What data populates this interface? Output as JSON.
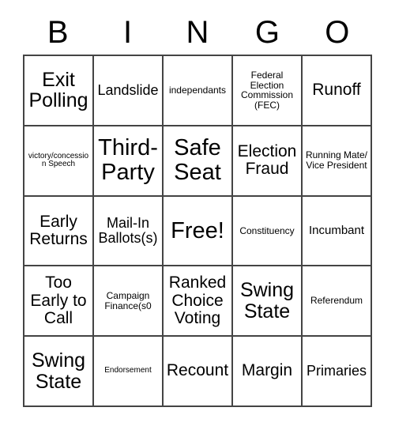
{
  "card": {
    "title": "BINGO",
    "header_letters": [
      "B",
      "I",
      "N",
      "G",
      "O"
    ],
    "free_space": {
      "row": 2,
      "col": 2,
      "label": "Free!"
    },
    "grid_size": "5x5",
    "rows": [
      [
        {
          "text": "Exit Polling",
          "size": "xl"
        },
        {
          "text": "Landslide",
          "size": "m"
        },
        {
          "text": "independants",
          "size": "xs"
        },
        {
          "text": "Federal Election Commission (FEC)",
          "size": "xs"
        },
        {
          "text": "Runoff",
          "size": "l"
        }
      ],
      [
        {
          "text": "victory/concession Speech",
          "size": "xxs"
        },
        {
          "text": "Third-Party",
          "size": "xxl"
        },
        {
          "text": "Safe Seat",
          "size": "xxl"
        },
        {
          "text": "Election Fraud",
          "size": "l"
        },
        {
          "text": "Running Mate/ Vice President",
          "size": "xs"
        }
      ],
      [
        {
          "text": "Early Returns",
          "size": "l"
        },
        {
          "text": "Mail-In Ballots(s)",
          "size": "m"
        },
        {
          "text": "Free!",
          "size": "xxl"
        },
        {
          "text": "Constituency",
          "size": "xs"
        },
        {
          "text": "Incumbant",
          "size": "s"
        }
      ],
      [
        {
          "text": "Too Early to Call",
          "size": "l"
        },
        {
          "text": "Campaign Finance(s0",
          "size": "xs"
        },
        {
          "text": "Ranked Choice Voting",
          "size": "l"
        },
        {
          "text": "Swing State",
          "size": "xl"
        },
        {
          "text": "Referendum",
          "size": "xs"
        }
      ],
      [
        {
          "text": "Swing State",
          "size": "xl"
        },
        {
          "text": "Endorsement",
          "size": "xxs"
        },
        {
          "text": "Recount",
          "size": "l"
        },
        {
          "text": "Margin",
          "size": "l"
        },
        {
          "text": "Primaries",
          "size": "m"
        }
      ]
    ]
  },
  "colors": {
    "background": "#ffffff",
    "text": "#000000",
    "border": "#444444"
  }
}
